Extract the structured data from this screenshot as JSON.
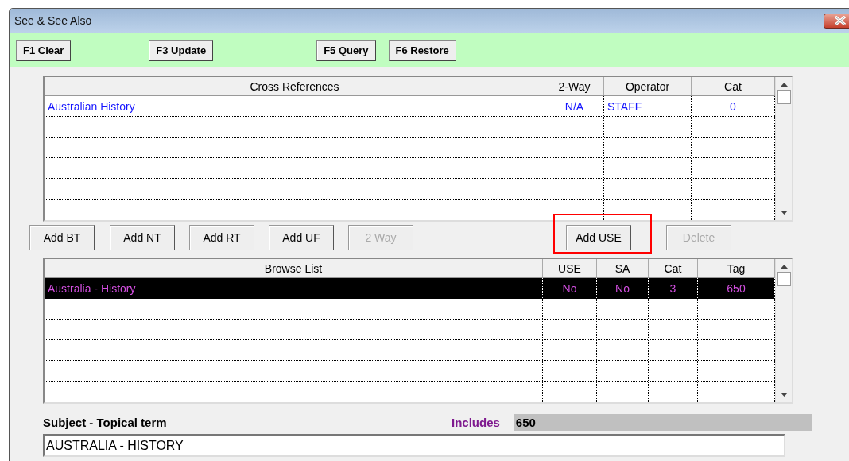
{
  "window": {
    "title": "See & See Also"
  },
  "toolbar": [
    {
      "label": "F1 Clear"
    },
    {
      "label": "F3 Update"
    },
    {
      "label": "F5 Query"
    },
    {
      "label": "F6 Restore"
    }
  ],
  "cross_references": {
    "columns": [
      "Cross References",
      "2-Way",
      "Operator",
      "Cat"
    ],
    "rows": [
      [
        "Australian History",
        "N/A",
        "STAFF",
        "0"
      ]
    ]
  },
  "actions": [
    {
      "label": "Add BT",
      "disabled": false,
      "highlighted": false
    },
    {
      "label": "Add NT",
      "disabled": false,
      "highlighted": false
    },
    {
      "label": "Add RT",
      "disabled": false,
      "highlighted": false
    },
    {
      "label": "Add UF",
      "disabled": false,
      "highlighted": false
    },
    {
      "label": "2 Way",
      "disabled": true,
      "highlighted": false
    },
    {
      "label": "Add USE",
      "disabled": false,
      "highlighted": true
    },
    {
      "label": "Delete",
      "disabled": true,
      "highlighted": false
    }
  ],
  "browse_list": {
    "columns": [
      "Browse List",
      "USE",
      "SA",
      "Cat",
      "Tag"
    ],
    "rows": [
      {
        "cells": [
          "Australia - History",
          "No",
          "No",
          "3",
          "650"
        ],
        "selected": true
      }
    ]
  },
  "subject": {
    "label": "Subject - Topical term",
    "includes_label": "Includes",
    "includes_value": "650",
    "value": "AUSTRALIA - HISTORY"
  }
}
